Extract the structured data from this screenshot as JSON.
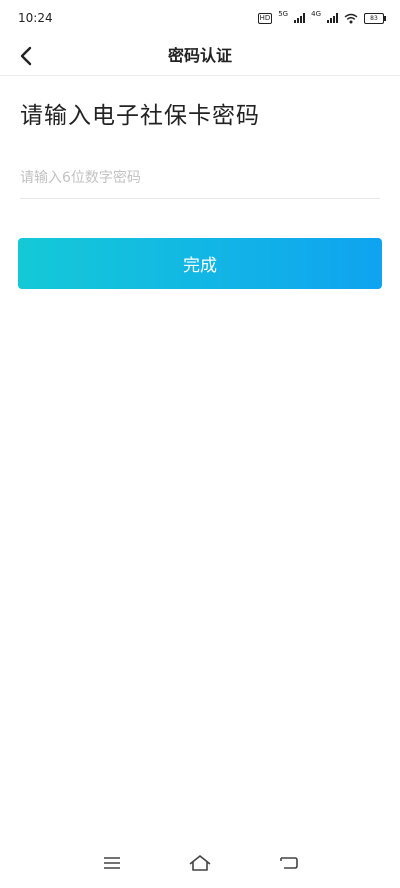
{
  "status_bar": {
    "time": "10:24",
    "hd_tag": "HD",
    "net_5g": "5G",
    "net_4g": "4G",
    "battery": "83"
  },
  "nav": {
    "title": "密码认证",
    "back_icon": "chevron-left-icon"
  },
  "form": {
    "heading": "请输入电子社保卡密码",
    "password_placeholder": "请输入6位数字密码",
    "password_value": "",
    "submit_label": "完成"
  },
  "system_nav": {
    "menu_icon": "menu-icon",
    "home_icon": "home-icon",
    "back_icon": "back-icon"
  },
  "colors": {
    "button_gradient_start": "#14c9d6",
    "button_gradient_end": "#0fa3f0",
    "placeholder": "#c2c2c2",
    "text": "#222222"
  }
}
